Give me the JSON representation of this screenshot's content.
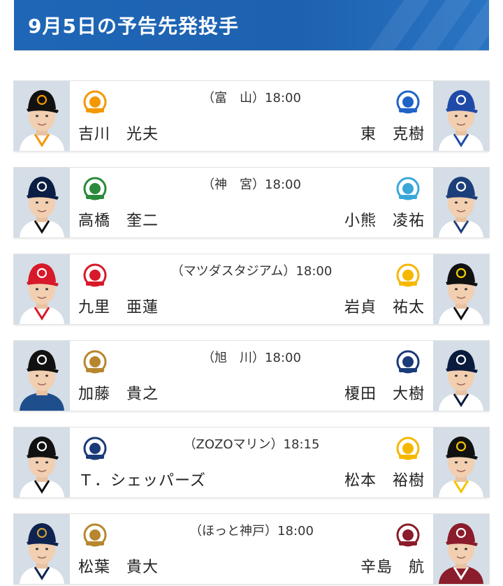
{
  "header": {
    "title": "9月5日の予告先発投手"
  },
  "games": [
    {
      "venue": "（富　山）18:00",
      "left_team": "giants",
      "left_pitcher": "吉川　光夫",
      "right_team": "baystars",
      "right_pitcher": "東　克樹",
      "left_colors": {
        "cap": "#111111",
        "logo": "#f39800",
        "jersey": "#ffffff",
        "trim": "#f39800"
      },
      "right_colors": {
        "cap": "#1f4aa8",
        "logo": "#ffffff",
        "jersey": "#ffffff",
        "trim": "#1f4aa8"
      }
    },
    {
      "venue": "（神　宮）18:00",
      "left_team": "swallows",
      "left_pitcher": "高橋　奎二",
      "right_team": "dragons",
      "right_pitcher": "小熊　凌祐",
      "left_colors": {
        "cap": "#0b1f44",
        "logo": "#ffffff",
        "jersey": "#ffffff",
        "trim": "#111111"
      },
      "right_colors": {
        "cap": "#1c3f7a",
        "logo": "#ffffff",
        "jersey": "#ffffff",
        "trim": "#1c3f7a"
      }
    },
    {
      "venue": "（マツダスタジアム）18:00",
      "left_team": "carp",
      "left_pitcher": "九里　亜蓮",
      "right_team": "tigers",
      "right_pitcher": "岩貞　祐太",
      "left_colors": {
        "cap": "#d7192a",
        "logo": "#ffffff",
        "jersey": "#ffffff",
        "trim": "#d7192a"
      },
      "right_colors": {
        "cap": "#111111",
        "logo": "#f5d300",
        "jersey": "#ffffff",
        "trim": "#111111"
      }
    },
    {
      "venue": "（旭　川）18:00",
      "left_team": "fighters",
      "left_pitcher": "加藤　貴之",
      "right_team": "lions",
      "right_pitcher": "榎田　大樹",
      "left_colors": {
        "cap": "#111111",
        "logo": "#ffffff",
        "jersey": "#1f4e8c",
        "trim": "#1f4e8c"
      },
      "right_colors": {
        "cap": "#0a1b3d",
        "logo": "#ffffff",
        "jersey": "#ffffff",
        "trim": "#0a1b3d"
      }
    },
    {
      "venue": "（ZOZOマリン）18:15",
      "left_team": "marines",
      "left_pitcher": "Ｔ．シェッパーズ",
      "right_team": "hawks",
      "right_pitcher": "松本　裕樹",
      "left_colors": {
        "cap": "#111111",
        "logo": "#ffffff",
        "jersey": "#ffffff",
        "trim": "#111111"
      },
      "right_colors": {
        "cap": "#111111",
        "logo": "#f5c400",
        "jersey": "#ffffff",
        "trim": "#f5c400"
      }
    },
    {
      "venue": "（ほっと神戸）18:00",
      "left_team": "buffaloes",
      "left_pitcher": "松葉　貴大",
      "right_team": "eagles",
      "right_pitcher": "辛島　航",
      "left_colors": {
        "cap": "#0f2350",
        "logo": "#c9a23a",
        "jersey": "#ffffff",
        "trim": "#0f2350"
      },
      "right_colors": {
        "cap": "#8a1c2b",
        "logo": "#ffffff",
        "jersey": "#8a1c2b",
        "trim": "#ffffff"
      }
    }
  ],
  "team_logos": {
    "giants": {
      "icon": "giants-logo-icon",
      "color": "#f39800"
    },
    "baystars": {
      "icon": "baystars-logo-icon",
      "color": "#1f63c6"
    },
    "swallows": {
      "icon": "swallows-logo-icon",
      "color": "#2a8a3a"
    },
    "dragons": {
      "icon": "dragons-logo-icon",
      "color": "#3aa7d9"
    },
    "carp": {
      "icon": "carp-logo-icon",
      "color": "#d7192a"
    },
    "tigers": {
      "icon": "tigers-logo-icon",
      "color": "#f5b800"
    },
    "fighters": {
      "icon": "fighters-logo-icon",
      "color": "#b8862f"
    },
    "lions": {
      "icon": "lions-logo-icon",
      "color": "#1b3a78"
    },
    "marines": {
      "icon": "marines-logo-icon",
      "color": "#1b3a78"
    },
    "hawks": {
      "icon": "hawks-logo-icon",
      "color": "#f5b800"
    },
    "buffaloes": {
      "icon": "buffaloes-logo-icon",
      "color": "#b8862f"
    },
    "eagles": {
      "icon": "eagles-logo-icon",
      "color": "#8a1c2b"
    }
  }
}
